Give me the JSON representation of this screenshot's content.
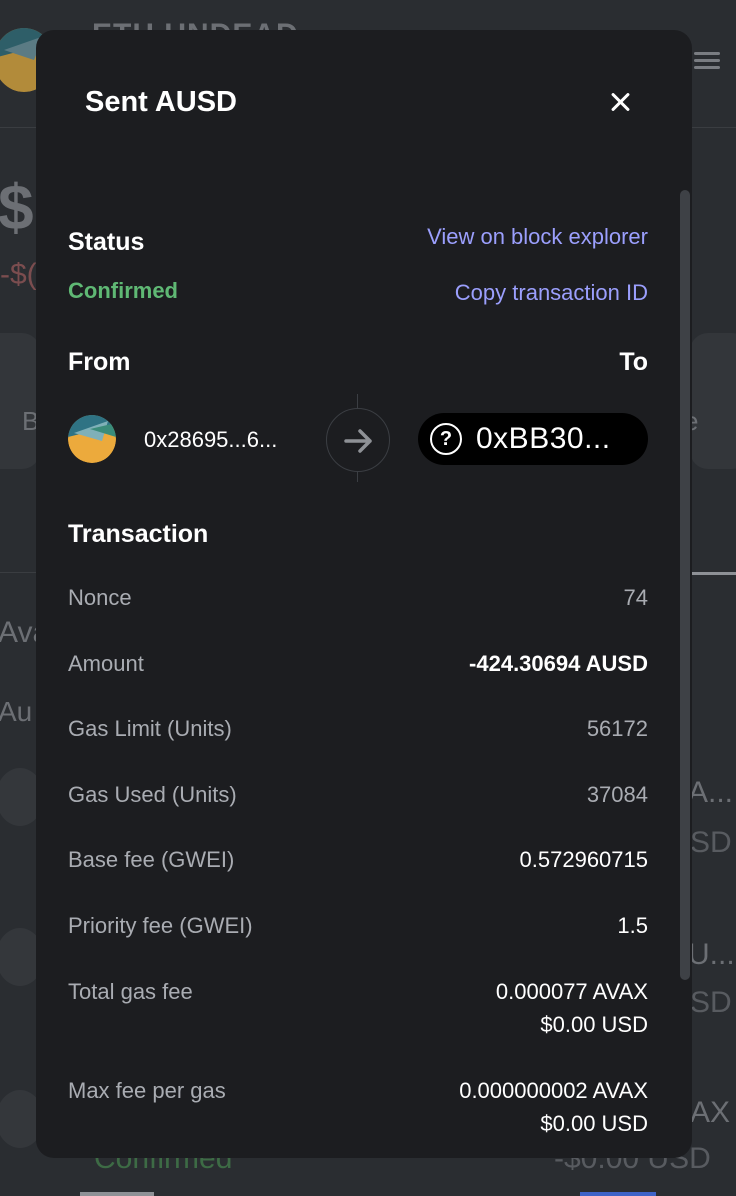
{
  "background": {
    "wallet_title": "ETH UNDEAD",
    "balance_fragment": "$",
    "change_fragment": "-$(",
    "left_button_letter": "B",
    "right_button_letter": "e",
    "section_fragment": "Ava",
    "sub_fragment": "Au",
    "row1_right_top": "A...",
    "row1_right_bottom": "SD",
    "row2_right_top": "U...",
    "row2_right_bottom": "SD",
    "row3_right_top": "AX",
    "row3_confirmed": "Confirmed",
    "row3_usd": "-$0.00 USD"
  },
  "modal": {
    "title": "Sent AUSD",
    "status": {
      "label": "Status",
      "value": "Confirmed",
      "view_link": "View on block explorer",
      "copy_link": "Copy transaction ID"
    },
    "from_label": "From",
    "to_label": "To",
    "from_address": "0x28695...6...",
    "to_address": "0xBB30...",
    "transaction": {
      "heading": "Transaction",
      "rows": [
        {
          "label": "Nonce",
          "value": "74"
        },
        {
          "label": "Amount",
          "value": "-424.30694 AUSD"
        },
        {
          "label": "Gas Limit (Units)",
          "value": "56172"
        },
        {
          "label": "Gas Used (Units)",
          "value": "37084"
        },
        {
          "label": "Base fee (GWEI)",
          "value": "0.572960715"
        },
        {
          "label": "Priority fee (GWEI)",
          "value": "1.5"
        },
        {
          "label": "Total gas fee",
          "value": "0.000077 AVAX",
          "sub": "$0.00 USD"
        },
        {
          "label": "Max fee per gas",
          "value": "0.000000002 AVAX",
          "sub": "$0.00 USD"
        }
      ]
    }
  },
  "colors": {
    "confirmed_green": "#5fb874",
    "link_purple": "#9b9ffd",
    "modal_bg": "#1c1d20"
  },
  "icons": {
    "close": "close-icon",
    "arrow": "arrow-right-icon",
    "unknown_recipient": "question-circle-icon",
    "menu": "hamburger-menu-icon"
  }
}
